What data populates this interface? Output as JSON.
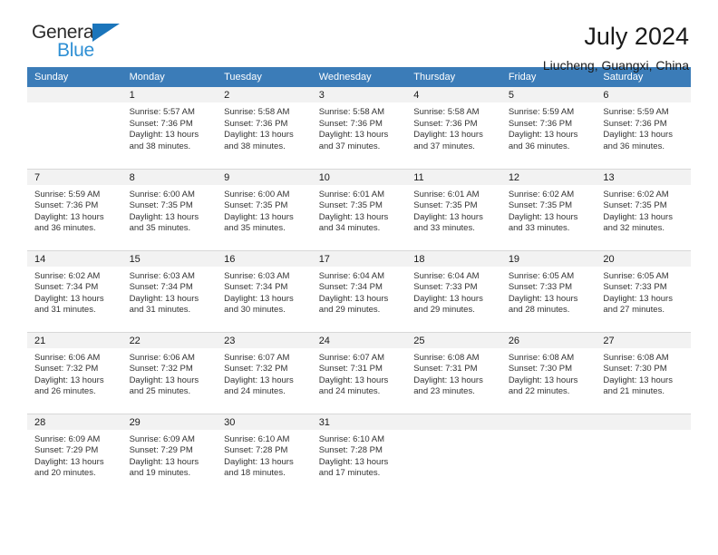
{
  "brand": {
    "name_part1": "General",
    "name_part2": "Blue",
    "accent_color": "#2e8fd4",
    "triangle_color": "#1b75bb"
  },
  "header": {
    "title": "July 2024",
    "subtitle": "Liucheng, Guangxi, China",
    "header_bg_color": "#3b7cb8"
  },
  "weekdays": [
    "Sunday",
    "Monday",
    "Tuesday",
    "Wednesday",
    "Thursday",
    "Friday",
    "Saturday"
  ],
  "weeks": [
    [
      {
        "day": "",
        "sunrise": "",
        "sunset": "",
        "daylight_line1": "",
        "daylight_line2": ""
      },
      {
        "day": "1",
        "sunrise": "Sunrise: 5:57 AM",
        "sunset": "Sunset: 7:36 PM",
        "daylight_line1": "Daylight: 13 hours",
        "daylight_line2": "and 38 minutes."
      },
      {
        "day": "2",
        "sunrise": "Sunrise: 5:58 AM",
        "sunset": "Sunset: 7:36 PM",
        "daylight_line1": "Daylight: 13 hours",
        "daylight_line2": "and 38 minutes."
      },
      {
        "day": "3",
        "sunrise": "Sunrise: 5:58 AM",
        "sunset": "Sunset: 7:36 PM",
        "daylight_line1": "Daylight: 13 hours",
        "daylight_line2": "and 37 minutes."
      },
      {
        "day": "4",
        "sunrise": "Sunrise: 5:58 AM",
        "sunset": "Sunset: 7:36 PM",
        "daylight_line1": "Daylight: 13 hours",
        "daylight_line2": "and 37 minutes."
      },
      {
        "day": "5",
        "sunrise": "Sunrise: 5:59 AM",
        "sunset": "Sunset: 7:36 PM",
        "daylight_line1": "Daylight: 13 hours",
        "daylight_line2": "and 36 minutes."
      },
      {
        "day": "6",
        "sunrise": "Sunrise: 5:59 AM",
        "sunset": "Sunset: 7:36 PM",
        "daylight_line1": "Daylight: 13 hours",
        "daylight_line2": "and 36 minutes."
      }
    ],
    [
      {
        "day": "7",
        "sunrise": "Sunrise: 5:59 AM",
        "sunset": "Sunset: 7:36 PM",
        "daylight_line1": "Daylight: 13 hours",
        "daylight_line2": "and 36 minutes."
      },
      {
        "day": "8",
        "sunrise": "Sunrise: 6:00 AM",
        "sunset": "Sunset: 7:35 PM",
        "daylight_line1": "Daylight: 13 hours",
        "daylight_line2": "and 35 minutes."
      },
      {
        "day": "9",
        "sunrise": "Sunrise: 6:00 AM",
        "sunset": "Sunset: 7:35 PM",
        "daylight_line1": "Daylight: 13 hours",
        "daylight_line2": "and 35 minutes."
      },
      {
        "day": "10",
        "sunrise": "Sunrise: 6:01 AM",
        "sunset": "Sunset: 7:35 PM",
        "daylight_line1": "Daylight: 13 hours",
        "daylight_line2": "and 34 minutes."
      },
      {
        "day": "11",
        "sunrise": "Sunrise: 6:01 AM",
        "sunset": "Sunset: 7:35 PM",
        "daylight_line1": "Daylight: 13 hours",
        "daylight_line2": "and 33 minutes."
      },
      {
        "day": "12",
        "sunrise": "Sunrise: 6:02 AM",
        "sunset": "Sunset: 7:35 PM",
        "daylight_line1": "Daylight: 13 hours",
        "daylight_line2": "and 33 minutes."
      },
      {
        "day": "13",
        "sunrise": "Sunrise: 6:02 AM",
        "sunset": "Sunset: 7:35 PM",
        "daylight_line1": "Daylight: 13 hours",
        "daylight_line2": "and 32 minutes."
      }
    ],
    [
      {
        "day": "14",
        "sunrise": "Sunrise: 6:02 AM",
        "sunset": "Sunset: 7:34 PM",
        "daylight_line1": "Daylight: 13 hours",
        "daylight_line2": "and 31 minutes."
      },
      {
        "day": "15",
        "sunrise": "Sunrise: 6:03 AM",
        "sunset": "Sunset: 7:34 PM",
        "daylight_line1": "Daylight: 13 hours",
        "daylight_line2": "and 31 minutes."
      },
      {
        "day": "16",
        "sunrise": "Sunrise: 6:03 AM",
        "sunset": "Sunset: 7:34 PM",
        "daylight_line1": "Daylight: 13 hours",
        "daylight_line2": "and 30 minutes."
      },
      {
        "day": "17",
        "sunrise": "Sunrise: 6:04 AM",
        "sunset": "Sunset: 7:34 PM",
        "daylight_line1": "Daylight: 13 hours",
        "daylight_line2": "and 29 minutes."
      },
      {
        "day": "18",
        "sunrise": "Sunrise: 6:04 AM",
        "sunset": "Sunset: 7:33 PM",
        "daylight_line1": "Daylight: 13 hours",
        "daylight_line2": "and 29 minutes."
      },
      {
        "day": "19",
        "sunrise": "Sunrise: 6:05 AM",
        "sunset": "Sunset: 7:33 PM",
        "daylight_line1": "Daylight: 13 hours",
        "daylight_line2": "and 28 minutes."
      },
      {
        "day": "20",
        "sunrise": "Sunrise: 6:05 AM",
        "sunset": "Sunset: 7:33 PM",
        "daylight_line1": "Daylight: 13 hours",
        "daylight_line2": "and 27 minutes."
      }
    ],
    [
      {
        "day": "21",
        "sunrise": "Sunrise: 6:06 AM",
        "sunset": "Sunset: 7:32 PM",
        "daylight_line1": "Daylight: 13 hours",
        "daylight_line2": "and 26 minutes."
      },
      {
        "day": "22",
        "sunrise": "Sunrise: 6:06 AM",
        "sunset": "Sunset: 7:32 PM",
        "daylight_line1": "Daylight: 13 hours",
        "daylight_line2": "and 25 minutes."
      },
      {
        "day": "23",
        "sunrise": "Sunrise: 6:07 AM",
        "sunset": "Sunset: 7:32 PM",
        "daylight_line1": "Daylight: 13 hours",
        "daylight_line2": "and 24 minutes."
      },
      {
        "day": "24",
        "sunrise": "Sunrise: 6:07 AM",
        "sunset": "Sunset: 7:31 PM",
        "daylight_line1": "Daylight: 13 hours",
        "daylight_line2": "and 24 minutes."
      },
      {
        "day": "25",
        "sunrise": "Sunrise: 6:08 AM",
        "sunset": "Sunset: 7:31 PM",
        "daylight_line1": "Daylight: 13 hours",
        "daylight_line2": "and 23 minutes."
      },
      {
        "day": "26",
        "sunrise": "Sunrise: 6:08 AM",
        "sunset": "Sunset: 7:30 PM",
        "daylight_line1": "Daylight: 13 hours",
        "daylight_line2": "and 22 minutes."
      },
      {
        "day": "27",
        "sunrise": "Sunrise: 6:08 AM",
        "sunset": "Sunset: 7:30 PM",
        "daylight_line1": "Daylight: 13 hours",
        "daylight_line2": "and 21 minutes."
      }
    ],
    [
      {
        "day": "28",
        "sunrise": "Sunrise: 6:09 AM",
        "sunset": "Sunset: 7:29 PM",
        "daylight_line1": "Daylight: 13 hours",
        "daylight_line2": "and 20 minutes."
      },
      {
        "day": "29",
        "sunrise": "Sunrise: 6:09 AM",
        "sunset": "Sunset: 7:29 PM",
        "daylight_line1": "Daylight: 13 hours",
        "daylight_line2": "and 19 minutes."
      },
      {
        "day": "30",
        "sunrise": "Sunrise: 6:10 AM",
        "sunset": "Sunset: 7:28 PM",
        "daylight_line1": "Daylight: 13 hours",
        "daylight_line2": "and 18 minutes."
      },
      {
        "day": "31",
        "sunrise": "Sunrise: 6:10 AM",
        "sunset": "Sunset: 7:28 PM",
        "daylight_line1": "Daylight: 13 hours",
        "daylight_line2": "and 17 minutes."
      },
      {
        "day": "",
        "sunrise": "",
        "sunset": "",
        "daylight_line1": "",
        "daylight_line2": ""
      },
      {
        "day": "",
        "sunrise": "",
        "sunset": "",
        "daylight_line1": "",
        "daylight_line2": ""
      },
      {
        "day": "",
        "sunrise": "",
        "sunset": "",
        "daylight_line1": "",
        "daylight_line2": ""
      }
    ]
  ]
}
